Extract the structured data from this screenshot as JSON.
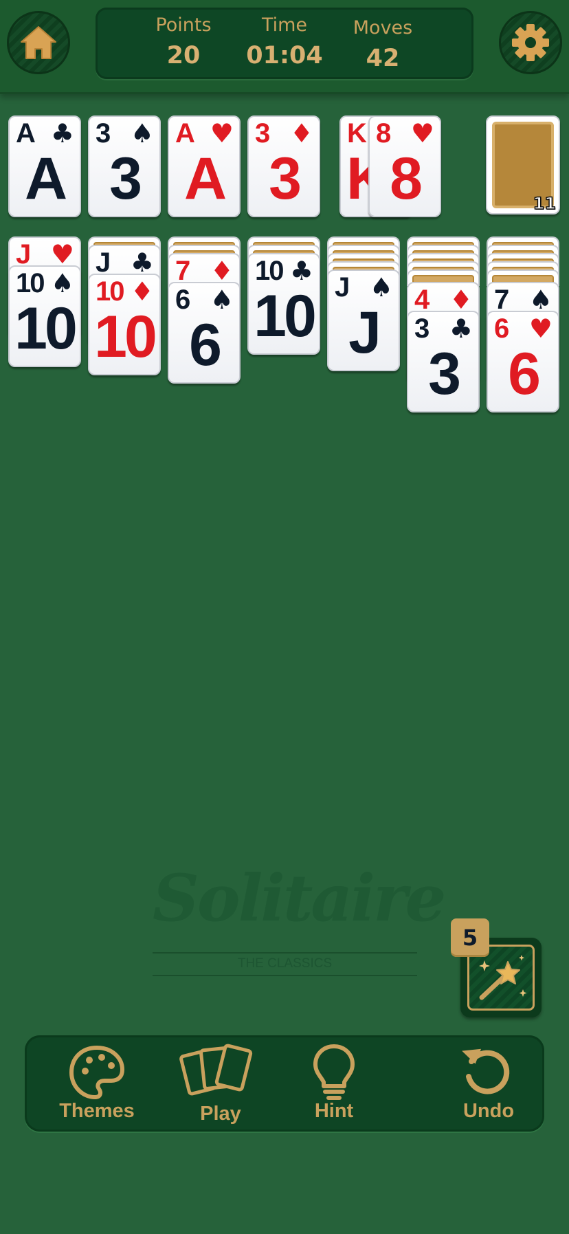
{
  "header": {
    "home_icon": "home-icon",
    "settings_icon": "gear-icon",
    "stats": [
      {
        "label": "Points",
        "value": "20"
      },
      {
        "label": "Time",
        "value": "01:04"
      },
      {
        "label": "Moves",
        "value": "42"
      }
    ]
  },
  "foundations": [
    {
      "rank": "A",
      "suit": "♣",
      "color": "black"
    },
    {
      "rank": "3",
      "suit": "♠",
      "color": "black"
    },
    {
      "rank": "A",
      "suit": "♥",
      "color": "red"
    },
    {
      "rank": "3",
      "suit": "♦",
      "color": "red"
    }
  ],
  "waste": [
    {
      "rank": "K",
      "suit": "",
      "color": "red"
    },
    {
      "rank": "8",
      "suit": "♥",
      "color": "red"
    }
  ],
  "stock": {
    "count": "11"
  },
  "tableau": [
    {
      "face_up": [
        {
          "rank": "J",
          "suit": "♥",
          "color": "red"
        },
        {
          "rank": "10",
          "suit": "♠",
          "color": "black"
        }
      ]
    },
    {
      "face_up": [
        {
          "rank": "J",
          "suit": "♣",
          "color": "black"
        },
        {
          "rank": "10",
          "suit": "♦",
          "color": "red"
        }
      ]
    },
    {
      "face_up": [
        {
          "rank": "7",
          "suit": "♦",
          "color": "red"
        },
        {
          "rank": "6",
          "suit": "♠",
          "color": "black"
        }
      ]
    },
    {
      "face_up": [
        {
          "rank": "10",
          "suit": "♣",
          "color": "black"
        }
      ]
    },
    {
      "face_up": [
        {
          "rank": "J",
          "suit": "♠",
          "color": "black"
        }
      ]
    },
    {
      "face_up": [
        {
          "rank": "4",
          "suit": "♦",
          "color": "red"
        },
        {
          "rank": "3",
          "suit": "♣",
          "color": "black"
        }
      ]
    },
    {
      "face_up": [
        {
          "rank": "7",
          "suit": "♠",
          "color": "black"
        },
        {
          "rank": "6",
          "suit": "♥",
          "color": "red"
        }
      ]
    }
  ],
  "logo": {
    "title": "Solitaire",
    "subtitle": "THE CLASSICS"
  },
  "magic": {
    "count": "5",
    "icon": "magic-wand-icon"
  },
  "bottom_bar": [
    {
      "label": "Themes",
      "icon": "palette-icon"
    },
    {
      "label": "Play",
      "icon": "cards-icon"
    },
    {
      "label": "Hint",
      "icon": "lightbulb-icon"
    },
    {
      "label": "Undo",
      "icon": "undo-icon"
    }
  ],
  "colors": {
    "felt": "#26623a",
    "gold": "#c9a15d",
    "dark_panel": "#0e4524",
    "red_suit": "#e01b22",
    "black_suit": "#0e1a2b"
  }
}
